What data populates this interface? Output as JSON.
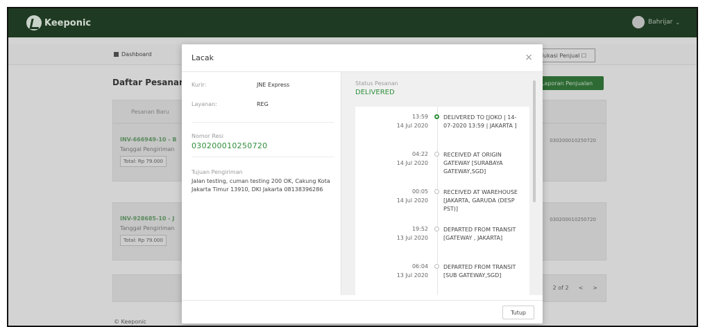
{
  "header": {
    "brand": "Keeponic",
    "user": "Bahrijar"
  },
  "subnav": {
    "dashboard": "Dashboard",
    "edu_button": "Edukasi Penjual ☐"
  },
  "page": {
    "title": "Daftar Pesanan",
    "report_button": "Laporan Penjualan",
    "tab": "Pesanan Baru",
    "orders": [
      {
        "id": "INV-666949-10 - B",
        "date_label": "Tanggal Pengiriman",
        "total": "Total: Rp 79.000",
        "resi": "030200010250720"
      },
      {
        "id": "INV-928685-10 - J",
        "date_label": "Tanggal Pengiriman",
        "total": "Total: Rp 79.000",
        "resi": "030200010250720"
      }
    ],
    "pager": {
      "page_info": "2 of 2",
      "prev": "<",
      "next": ">"
    },
    "footer": "© Keeponic"
  },
  "modal": {
    "title": "Lacak",
    "close_symbol": "×",
    "courier_label": "Kurir:",
    "courier_value": "JNE Express",
    "service_label": "Layanan:",
    "service_value": "REG",
    "resi_label": "Nomor Resi",
    "resi_value": "030200010250720",
    "dest_label": "Tujuan Pengiriman",
    "dest_value": "Jalan testing, cuman testing 200 OK, Cakung Kota Jakarta Timur 13910, DKI Jakarta 08138396286",
    "status_label": "Status Pesanan",
    "status_value": "DELIVERED",
    "timeline": [
      {
        "time": "13:59",
        "date": "14 Jul 2020",
        "desc": "DELIVERED TO [JOKO | 14-07-2020 13:59 | JAKARTA ]"
      },
      {
        "time": "04:22",
        "date": "14 Jul 2020",
        "desc": "RECEIVED AT ORIGIN GATEWAY [SURABAYA GATEWAY,SGD]"
      },
      {
        "time": "00:05",
        "date": "14 Jul 2020",
        "desc": "RECEIVED AT WAREHOUSE [JAKARTA, GARUDA (DESP PST)]"
      },
      {
        "time": "19:52",
        "date": "13 Jul 2020",
        "desc": "DEPARTED FROM TRANSIT [GATEWAY , JAKARTA]"
      },
      {
        "time": "06:04",
        "date": "13 Jul 2020",
        "desc": "DEPARTED FROM TRANSIT [SUB GATEWAY,SGD]"
      }
    ],
    "close_button": "Tutup"
  },
  "colors": {
    "header": "#1f3a22",
    "accent_green": "#2f8f3a",
    "overlay": "#d3d3d3"
  }
}
